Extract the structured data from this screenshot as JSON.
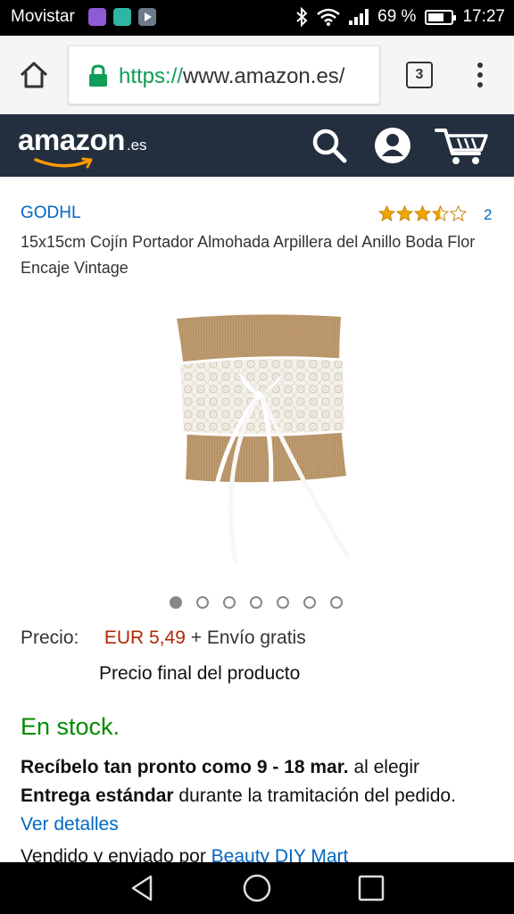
{
  "status_bar": {
    "carrier": "Movistar",
    "battery": "69 %",
    "battery_level": 0.69,
    "time": "17:27"
  },
  "browser": {
    "url_scheme": "https://",
    "url_host": "www.amazon.es/",
    "tab_count": "3"
  },
  "header": {
    "logo_word": "amazon",
    "logo_tld": ".es"
  },
  "product": {
    "brand": "GODHL",
    "rating": 3.5,
    "review_count": "2",
    "title": "15x15cm Cojín Portador Almohada Arpillera del Anillo Boda Flor Encaje Vintage",
    "image_count": 7,
    "active_image": 0
  },
  "price": {
    "label": "Precio:",
    "value": "EUR 5,49",
    "shipping": "+ Envío gratis",
    "note": "Precio final del producto"
  },
  "stock": {
    "status": "En stock."
  },
  "delivery": {
    "prefix": "Recíbelo tan pronto como 9 - 18 mar.",
    "mid": "al elegir",
    "option": "Entrega estándar",
    "suffix": "durante la tramitación del pedido.",
    "details_link": "Ver detalles"
  },
  "seller": {
    "text": "Vendido y enviado por",
    "name": "Beauty DIY Mart"
  },
  "colors": {
    "header_bg": "#232f3e",
    "price": "#b12704",
    "stock": "#008a00",
    "link": "#0066c0",
    "star": "#f0a600"
  }
}
